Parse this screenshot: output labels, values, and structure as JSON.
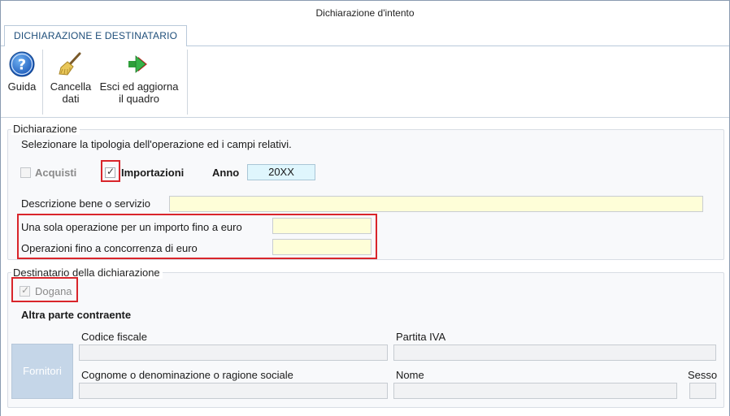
{
  "window": {
    "title": "Dichiarazione d'intento"
  },
  "tabs": [
    {
      "label": "DICHIARAZIONE E DESTINATARIO"
    }
  ],
  "toolbar": {
    "help_label": "Guida",
    "clear_label_line1": "Cancella",
    "clear_label_line2": "dati",
    "exit_label_line1": "Esci ed aggiorna",
    "exit_label_line2": "il quadro"
  },
  "dichiarazione": {
    "legend": "Dichiarazione",
    "instructions": "Selezionare la tipologia dell'operazione ed i campi relativi.",
    "acquisti_label": "Acquisti",
    "acquisti_checked": false,
    "importazioni_label": "Importazioni",
    "importazioni_checked": true,
    "anno_label": "Anno",
    "anno_value": "20XX",
    "descrizione_label": "Descrizione bene o servizio",
    "descrizione_value": "",
    "sola_operazione_label": "Una sola operazione per un importo fino a euro",
    "sola_operazione_value": "",
    "concorrenza_label": "Operazioni fino a concorrenza di euro",
    "concorrenza_value": ""
  },
  "destinatario": {
    "legend": "Destinatario della dichiarazione",
    "dogana_label": "Dogana",
    "dogana_checked": true,
    "altra_parte_label": "Altra parte contraente",
    "codice_fiscale_label": "Codice fiscale",
    "partita_iva_label": "Partita IVA",
    "fornitori_button": "Fornitori",
    "cognome_label": "Cognome o denominazione o ragione sociale",
    "nome_label": "Nome",
    "sesso_label": "Sesso"
  },
  "colors": {
    "required_field": "#fefed8",
    "highlight_box": "#d9252b",
    "tab_text": "#1e4e7a"
  },
  "icons": {
    "help": "help-question-icon",
    "clear": "broom-icon",
    "exit": "green-arrow-icon"
  }
}
